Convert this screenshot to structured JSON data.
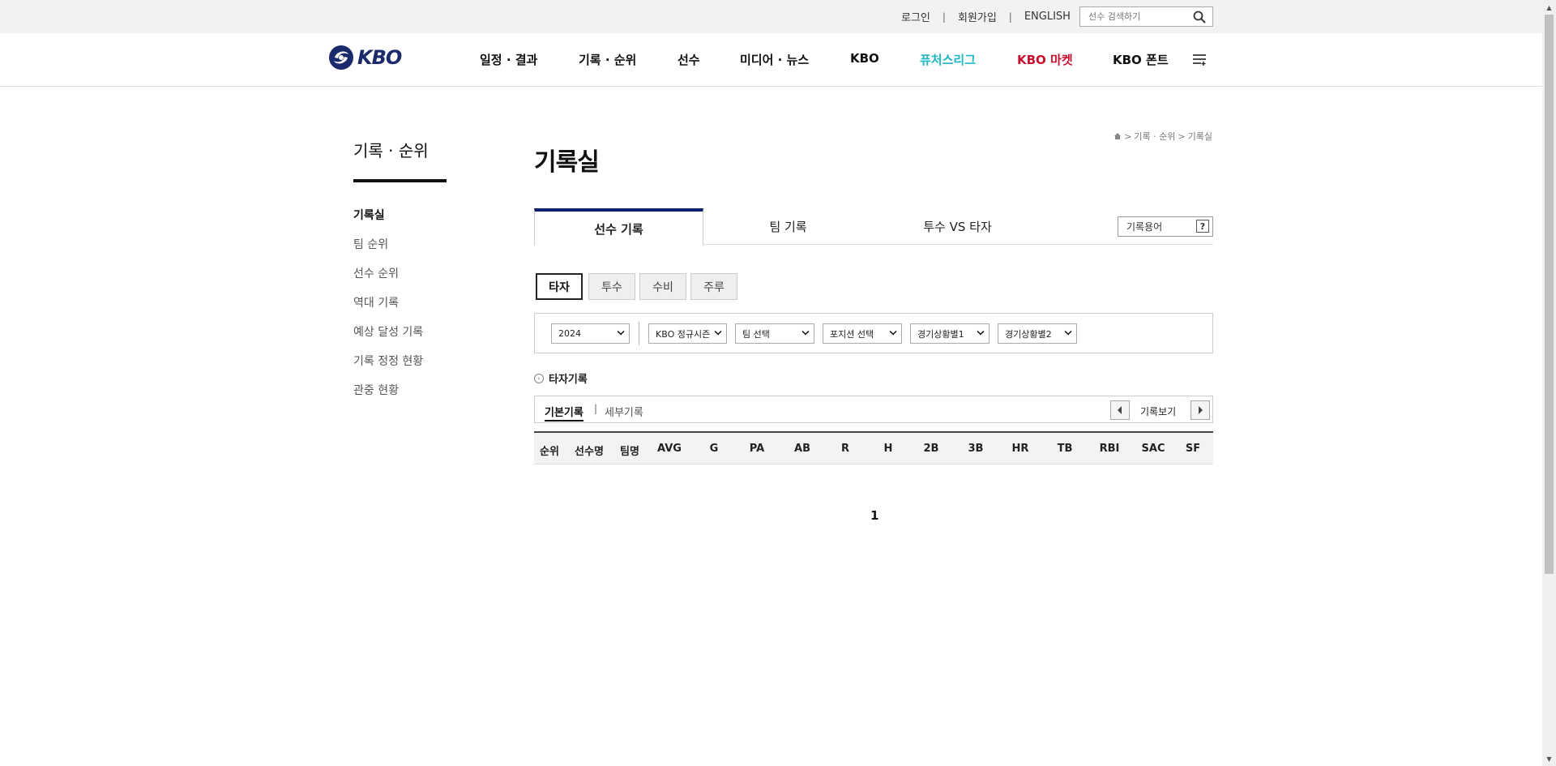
{
  "util": {
    "login": "로그인",
    "signup": "회원가입",
    "english": "ENGLISH",
    "separator": "|",
    "search_placeholder": "선수 검색하기",
    "search_icon": "search-icon"
  },
  "header": {
    "logo_text": "KBO",
    "nav": [
      {
        "label": "일정 · 결과"
      },
      {
        "label": "기록 · 순위"
      },
      {
        "label": "선수"
      },
      {
        "label": "미디어 · 뉴스"
      },
      {
        "label": "KBO"
      },
      {
        "label": "퓨처스리그"
      },
      {
        "label": "KBO 마켓"
      },
      {
        "label": "KBO 폰트"
      }
    ],
    "menu_icon": "hamburger-menu-icon",
    "colors": {
      "futures": "#1fb7c4",
      "market": "#c8102e",
      "brand": "#1b2a6b"
    }
  },
  "sidebar": {
    "title": "기록 · 순위",
    "items": [
      {
        "label": "기록실"
      },
      {
        "label": "팀 순위"
      },
      {
        "label": "선수 순위"
      },
      {
        "label": "역대 기록"
      },
      {
        "label": "예상 달성 기록"
      },
      {
        "label": "기록 정정 현황"
      },
      {
        "label": "관중 현황"
      }
    ]
  },
  "breadcrumb": {
    "home_icon": "home-icon",
    "sep": ">",
    "items": [
      "기록 · 순위",
      "기록실"
    ]
  },
  "main": {
    "title": "기록실",
    "tabs": [
      {
        "label": "선수 기록"
      },
      {
        "label": "팀 기록"
      },
      {
        "label": "투수 VS 타자"
      }
    ],
    "glossary": {
      "label": "기록용어",
      "help": "?"
    },
    "subtabs": [
      {
        "label": "타자"
      },
      {
        "label": "투수"
      },
      {
        "label": "수비"
      },
      {
        "label": "주루"
      }
    ],
    "filters": {
      "year": "2024",
      "series": "KBO 정규시즌",
      "team": "팀 선택",
      "position": "포지션 선택",
      "situation1": "경기상황별1",
      "situation2": "경기상황별2"
    },
    "section_label": "타자기록",
    "record_bar": {
      "basic": "기본기록",
      "sep": "|",
      "detail": "세부기록",
      "view": "기록보기"
    },
    "table_headers": [
      "순위",
      "선수명",
      "팀명",
      "AVG",
      "G",
      "PA",
      "AB",
      "R",
      "H",
      "2B",
      "3B",
      "HR",
      "TB",
      "RBI",
      "SAC",
      "SF"
    ],
    "pager": "1"
  }
}
